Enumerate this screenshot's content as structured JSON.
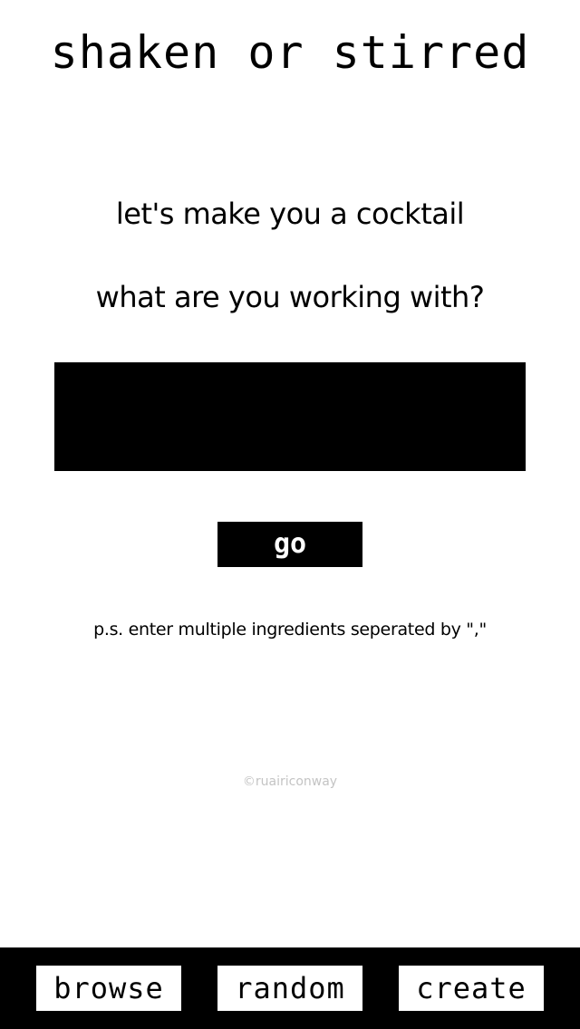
{
  "header": {
    "title": "shaken or stirred"
  },
  "main": {
    "headline_1": "let's make you a cocktail",
    "headline_2": "what are you working with?",
    "ingredient_input": {
      "value": "",
      "placeholder": ""
    },
    "go_label": "go",
    "hint": "p.s. enter multiple ingredients seperated by \",\"",
    "copyright": "©ruairiconway"
  },
  "nav": {
    "browse_label": "browse",
    "random_label": "random",
    "create_label": "create"
  },
  "colors": {
    "background": "#ffffff",
    "foreground": "#000000",
    "muted": "#c4c4c4"
  }
}
